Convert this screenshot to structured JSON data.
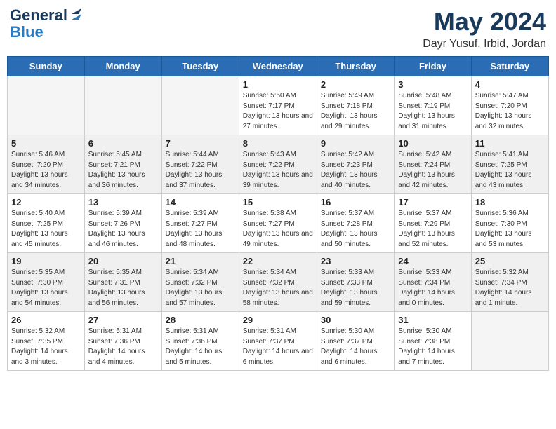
{
  "header": {
    "logo_line1": "General",
    "logo_line2": "Blue",
    "month": "May 2024",
    "location": "Dayr Yusuf, Irbid, Jordan"
  },
  "weekdays": [
    "Sunday",
    "Monday",
    "Tuesday",
    "Wednesday",
    "Thursday",
    "Friday",
    "Saturday"
  ],
  "weeks": [
    [
      {
        "day": "",
        "empty": true
      },
      {
        "day": "",
        "empty": true
      },
      {
        "day": "",
        "empty": true
      },
      {
        "day": "1",
        "sunrise": "Sunrise: 5:50 AM",
        "sunset": "Sunset: 7:17 PM",
        "daylight": "Daylight: 13 hours and 27 minutes."
      },
      {
        "day": "2",
        "sunrise": "Sunrise: 5:49 AM",
        "sunset": "Sunset: 7:18 PM",
        "daylight": "Daylight: 13 hours and 29 minutes."
      },
      {
        "day": "3",
        "sunrise": "Sunrise: 5:48 AM",
        "sunset": "Sunset: 7:19 PM",
        "daylight": "Daylight: 13 hours and 31 minutes."
      },
      {
        "day": "4",
        "sunrise": "Sunrise: 5:47 AM",
        "sunset": "Sunset: 7:20 PM",
        "daylight": "Daylight: 13 hours and 32 minutes."
      }
    ],
    [
      {
        "day": "5",
        "sunrise": "Sunrise: 5:46 AM",
        "sunset": "Sunset: 7:20 PM",
        "daylight": "Daylight: 13 hours and 34 minutes."
      },
      {
        "day": "6",
        "sunrise": "Sunrise: 5:45 AM",
        "sunset": "Sunset: 7:21 PM",
        "daylight": "Daylight: 13 hours and 36 minutes."
      },
      {
        "day": "7",
        "sunrise": "Sunrise: 5:44 AM",
        "sunset": "Sunset: 7:22 PM",
        "daylight": "Daylight: 13 hours and 37 minutes."
      },
      {
        "day": "8",
        "sunrise": "Sunrise: 5:43 AM",
        "sunset": "Sunset: 7:22 PM",
        "daylight": "Daylight: 13 hours and 39 minutes."
      },
      {
        "day": "9",
        "sunrise": "Sunrise: 5:42 AM",
        "sunset": "Sunset: 7:23 PM",
        "daylight": "Daylight: 13 hours and 40 minutes."
      },
      {
        "day": "10",
        "sunrise": "Sunrise: 5:42 AM",
        "sunset": "Sunset: 7:24 PM",
        "daylight": "Daylight: 13 hours and 42 minutes."
      },
      {
        "day": "11",
        "sunrise": "Sunrise: 5:41 AM",
        "sunset": "Sunset: 7:25 PM",
        "daylight": "Daylight: 13 hours and 43 minutes."
      }
    ],
    [
      {
        "day": "12",
        "sunrise": "Sunrise: 5:40 AM",
        "sunset": "Sunset: 7:25 PM",
        "daylight": "Daylight: 13 hours and 45 minutes."
      },
      {
        "day": "13",
        "sunrise": "Sunrise: 5:39 AM",
        "sunset": "Sunset: 7:26 PM",
        "daylight": "Daylight: 13 hours and 46 minutes."
      },
      {
        "day": "14",
        "sunrise": "Sunrise: 5:39 AM",
        "sunset": "Sunset: 7:27 PM",
        "daylight": "Daylight: 13 hours and 48 minutes."
      },
      {
        "day": "15",
        "sunrise": "Sunrise: 5:38 AM",
        "sunset": "Sunset: 7:27 PM",
        "daylight": "Daylight: 13 hours and 49 minutes."
      },
      {
        "day": "16",
        "sunrise": "Sunrise: 5:37 AM",
        "sunset": "Sunset: 7:28 PM",
        "daylight": "Daylight: 13 hours and 50 minutes."
      },
      {
        "day": "17",
        "sunrise": "Sunrise: 5:37 AM",
        "sunset": "Sunset: 7:29 PM",
        "daylight": "Daylight: 13 hours and 52 minutes."
      },
      {
        "day": "18",
        "sunrise": "Sunrise: 5:36 AM",
        "sunset": "Sunset: 7:30 PM",
        "daylight": "Daylight: 13 hours and 53 minutes."
      }
    ],
    [
      {
        "day": "19",
        "sunrise": "Sunrise: 5:35 AM",
        "sunset": "Sunset: 7:30 PM",
        "daylight": "Daylight: 13 hours and 54 minutes."
      },
      {
        "day": "20",
        "sunrise": "Sunrise: 5:35 AM",
        "sunset": "Sunset: 7:31 PM",
        "daylight": "Daylight: 13 hours and 56 minutes."
      },
      {
        "day": "21",
        "sunrise": "Sunrise: 5:34 AM",
        "sunset": "Sunset: 7:32 PM",
        "daylight": "Daylight: 13 hours and 57 minutes."
      },
      {
        "day": "22",
        "sunrise": "Sunrise: 5:34 AM",
        "sunset": "Sunset: 7:32 PM",
        "daylight": "Daylight: 13 hours and 58 minutes."
      },
      {
        "day": "23",
        "sunrise": "Sunrise: 5:33 AM",
        "sunset": "Sunset: 7:33 PM",
        "daylight": "Daylight: 13 hours and 59 minutes."
      },
      {
        "day": "24",
        "sunrise": "Sunrise: 5:33 AM",
        "sunset": "Sunset: 7:34 PM",
        "daylight": "Daylight: 14 hours and 0 minutes."
      },
      {
        "day": "25",
        "sunrise": "Sunrise: 5:32 AM",
        "sunset": "Sunset: 7:34 PM",
        "daylight": "Daylight: 14 hours and 1 minute."
      }
    ],
    [
      {
        "day": "26",
        "sunrise": "Sunrise: 5:32 AM",
        "sunset": "Sunset: 7:35 PM",
        "daylight": "Daylight: 14 hours and 3 minutes."
      },
      {
        "day": "27",
        "sunrise": "Sunrise: 5:31 AM",
        "sunset": "Sunset: 7:36 PM",
        "daylight": "Daylight: 14 hours and 4 minutes."
      },
      {
        "day": "28",
        "sunrise": "Sunrise: 5:31 AM",
        "sunset": "Sunset: 7:36 PM",
        "daylight": "Daylight: 14 hours and 5 minutes."
      },
      {
        "day": "29",
        "sunrise": "Sunrise: 5:31 AM",
        "sunset": "Sunset: 7:37 PM",
        "daylight": "Daylight: 14 hours and 6 minutes."
      },
      {
        "day": "30",
        "sunrise": "Sunrise: 5:30 AM",
        "sunset": "Sunset: 7:37 PM",
        "daylight": "Daylight: 14 hours and 6 minutes."
      },
      {
        "day": "31",
        "sunrise": "Sunrise: 5:30 AM",
        "sunset": "Sunset: 7:38 PM",
        "daylight": "Daylight: 14 hours and 7 minutes."
      },
      {
        "day": "",
        "empty": true
      }
    ]
  ]
}
